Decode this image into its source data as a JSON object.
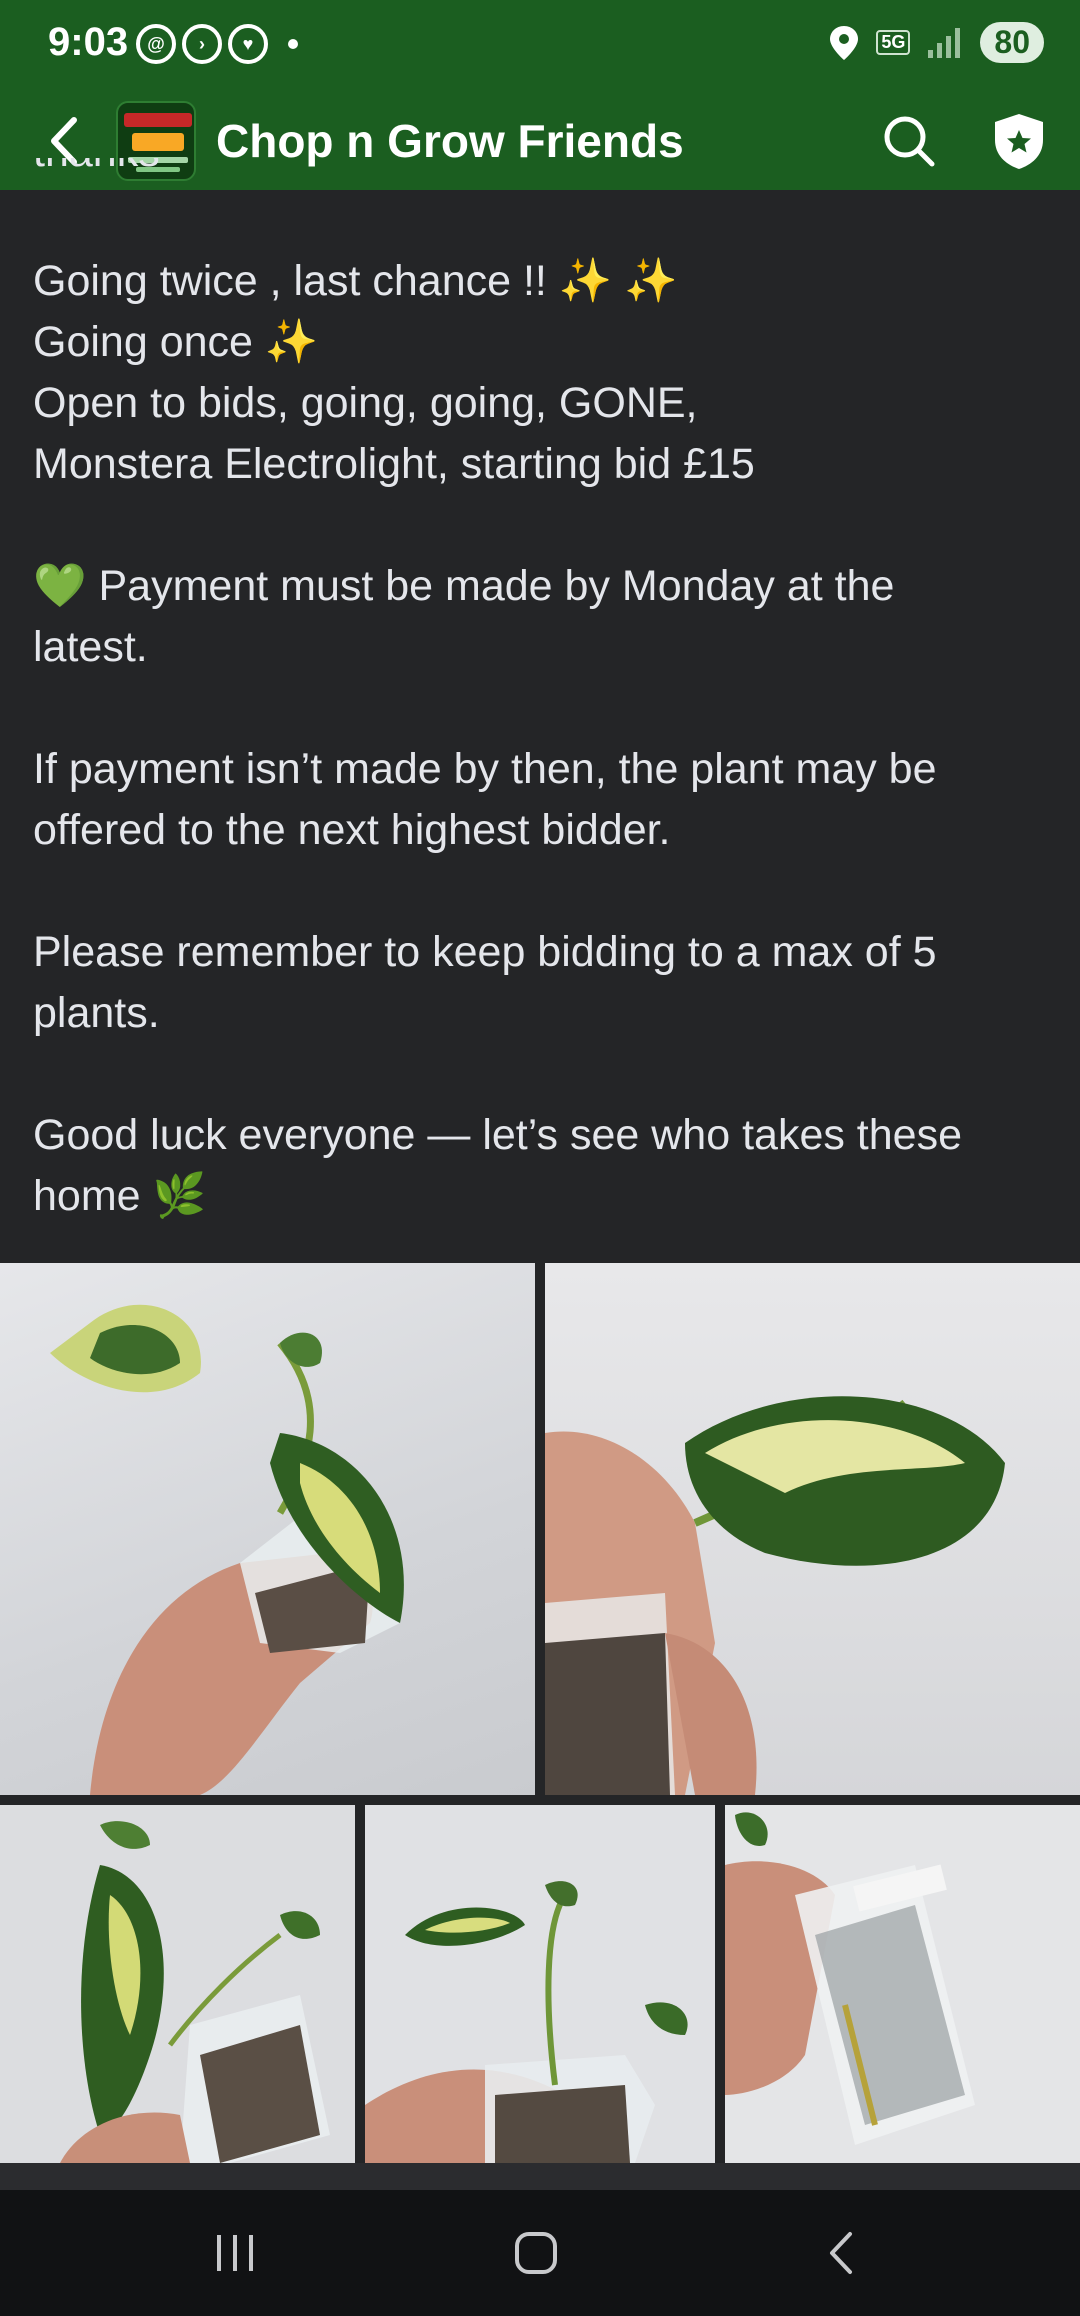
{
  "status_bar": {
    "time": "9:03",
    "network": "5G",
    "battery": "80",
    "left_icons": [
      "threads-icon",
      "messenger-icon",
      "app-icon",
      "notification-dot"
    ],
    "right_icons": [
      "location-icon",
      "5g-icon",
      "signal-icon",
      "battery-icon"
    ]
  },
  "app_bar": {
    "group_name": "Chop n Grow Friends",
    "back_icon": "chevron-left-icon",
    "search_icon": "search-icon",
    "shield_icon": "admin-shield-icon"
  },
  "post": {
    "cut_line": "thanks",
    "lines": [
      "Going twice , last chance !! ",
      "Going once ",
      "Open to bids, going, going, GONE,",
      "Monstera Electrolight, starting bid £15",
      " Payment must be made by Monday at the",
      "latest.",
      "If payment isn’t made by then, the plant may be",
      "offered to the next highest bidder.",
      "Please remember to keep bidding to a max of 5",
      "plants.",
      "Good luck everyone — let’s see who takes these",
      "home "
    ],
    "emoji": {
      "sparkles": "✨",
      "green_heart": "💚",
      "herb": "🌿"
    }
  },
  "photos": [
    {
      "alt_name": "photo-1"
    },
    {
      "alt_name": "photo-2"
    },
    {
      "alt_name": "photo-3"
    },
    {
      "alt_name": "photo-4"
    },
    {
      "alt_name": "photo-5"
    }
  ],
  "colors": {
    "header_green": "#1b5e20",
    "background": "#242527",
    "text": "#e4e6eb"
  }
}
